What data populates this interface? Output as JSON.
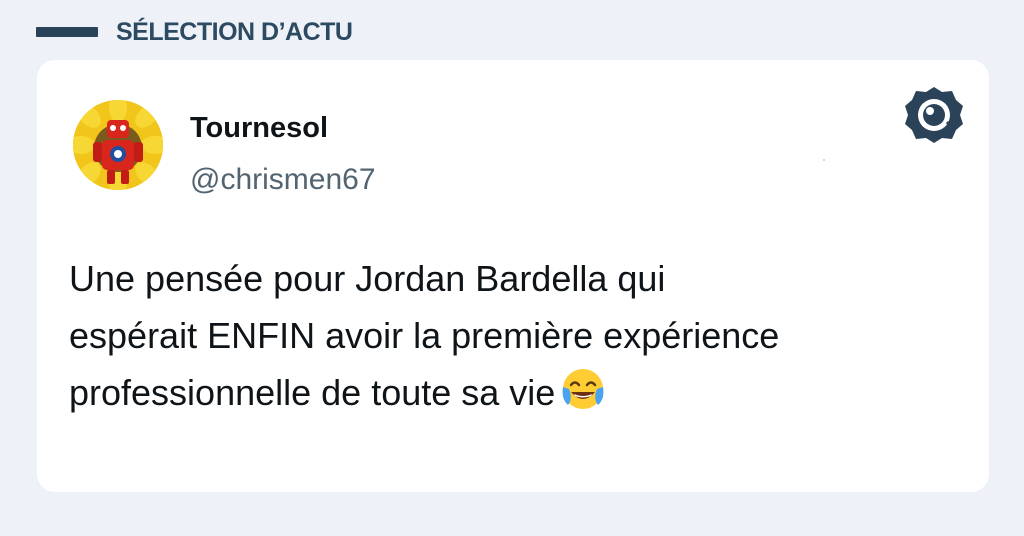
{
  "header": {
    "label": "SÉLECTION D’ACTU"
  },
  "tweet": {
    "author_name": "Tournesol",
    "author_handle": "@chrismen67",
    "text_lines": [
      "Une pensée pour Jordan Bardella qui",
      "espérait ENFIN avoir la première expérience",
      "professionnelle de toute sa vie"
    ],
    "emoji": "face-with-tears-of-joy",
    "logo": "brand-logo-icon"
  },
  "colors": {
    "page_bg": "#eef2f8",
    "card_bg": "#ffffff",
    "header_accent": "#2a4359",
    "text": "#0f1419",
    "handle": "#536471"
  }
}
